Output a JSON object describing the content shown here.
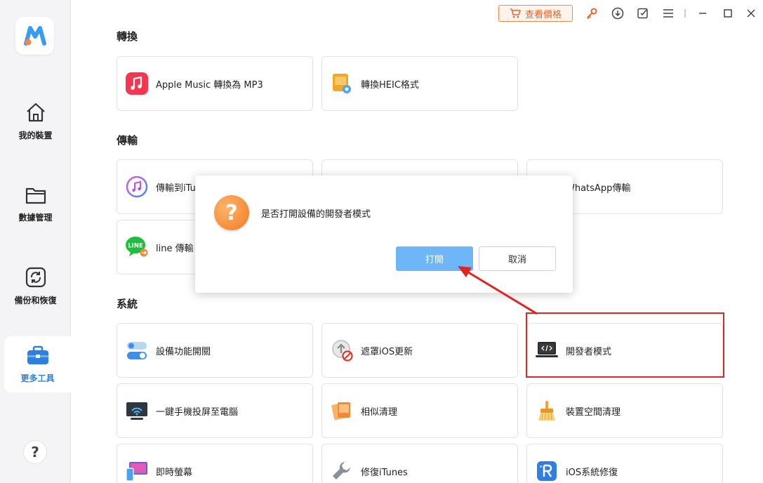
{
  "titlebar": {
    "price_label": "查看價格",
    "icons": [
      "cart-icon",
      "key-icon",
      "download-icon",
      "feedback-icon",
      "menu-icon",
      "minimize-icon",
      "maximize-icon",
      "close-icon"
    ]
  },
  "sidebar": {
    "items": [
      {
        "label": "我的裝置",
        "icon": "home-icon"
      },
      {
        "label": "數據管理",
        "icon": "folder-icon"
      },
      {
        "label": "備份和恢復",
        "icon": "backup-icon"
      },
      {
        "label": "更多工具",
        "icon": "toolbox-icon",
        "active": true
      }
    ],
    "help": "?"
  },
  "sections": {
    "convert": {
      "title": "轉換",
      "items": [
        {
          "label": "Apple Music 轉換為 MP3",
          "icon": "music-icon"
        },
        {
          "label": "轉換HEIC格式",
          "icon": "heic-icon"
        }
      ]
    },
    "transfer": {
      "title": "傳輸",
      "items": [
        {
          "label": "傳輸到iTu",
          "icon": "itunes-icon"
        },
        {
          "label": "",
          "icon": "transfer-icon"
        },
        {
          "label": "WhatsApp傳輸",
          "icon": "whatsapp-icon"
        },
        {
          "label": "line 傳輸",
          "icon": "line-icon"
        }
      ]
    },
    "system": {
      "title": "系統",
      "items": [
        {
          "label": "設備功能開關",
          "icon": "toggle-icon"
        },
        {
          "label": "遮罩iOS更新",
          "icon": "block-update-icon"
        },
        {
          "label": "開發者模式",
          "icon": "developer-icon"
        },
        {
          "label": "一鍵手機投屏至電腦",
          "icon": "mirror-icon"
        },
        {
          "label": "相似清理",
          "icon": "photos-icon"
        },
        {
          "label": "裝置空間清理",
          "icon": "broom-icon"
        },
        {
          "label": "即時螢幕",
          "icon": "screen-icon"
        },
        {
          "label": "修復iTunes",
          "icon": "wrench-icon"
        },
        {
          "label": "iOS系統修復",
          "icon": "repair-icon"
        }
      ]
    }
  },
  "dialog": {
    "message": "是否打開設備的開發者模式",
    "confirm_label": "打開",
    "cancel_label": "取消"
  },
  "colors": {
    "accent": "#2f7fe0",
    "highlight": "#e02424",
    "confirm_button": "#6eb6f7",
    "price_orange": "#e8652a"
  }
}
